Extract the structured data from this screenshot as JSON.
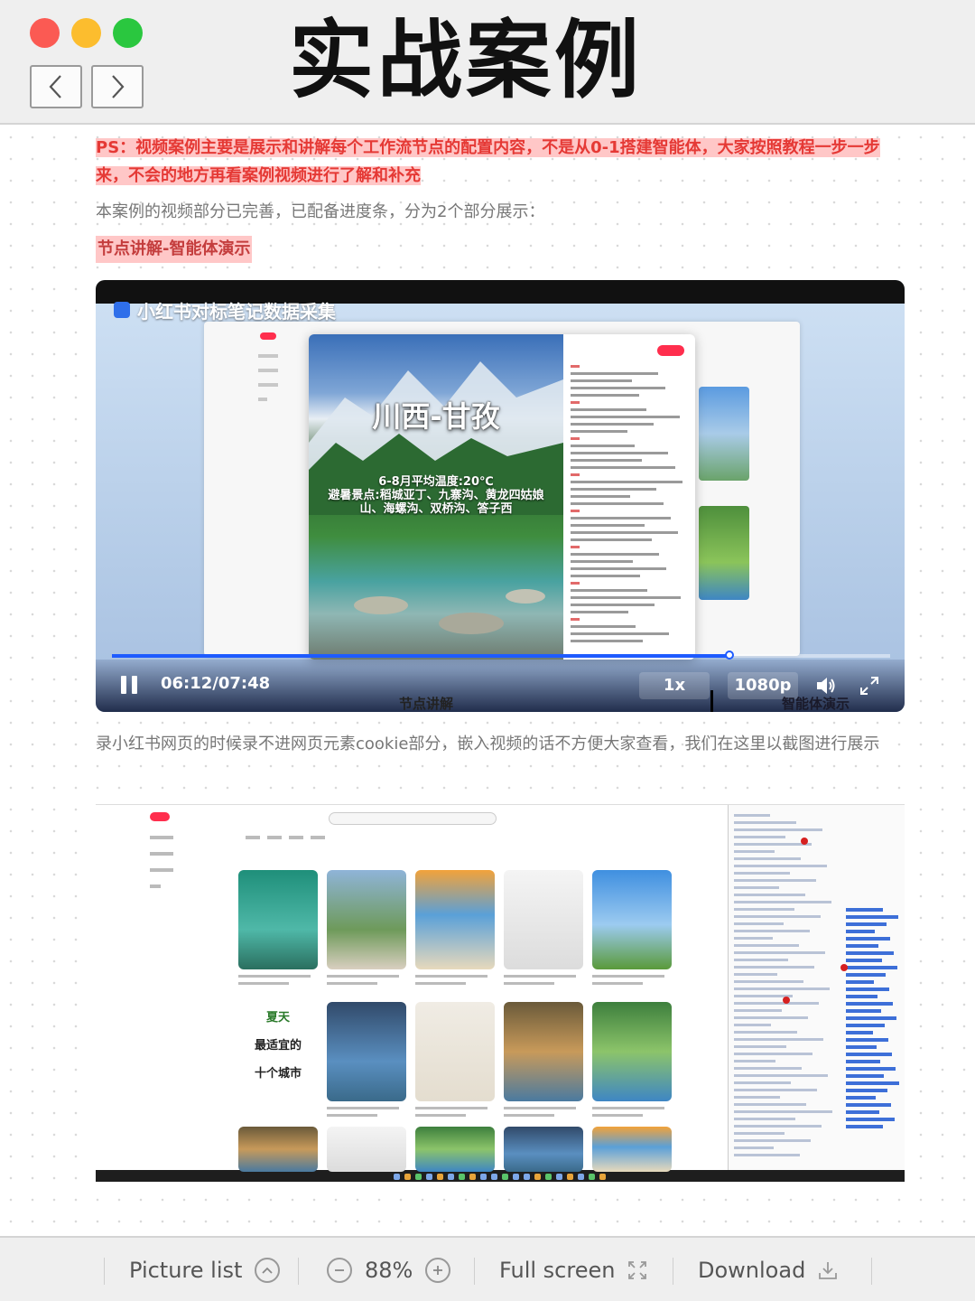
{
  "window": {
    "title": "实战案例",
    "controls": [
      "close",
      "minimize",
      "maximize"
    ],
    "nav": {
      "back_icon": "chevron-left-icon",
      "forward_icon": "chevron-right-icon"
    }
  },
  "article": {
    "ps_note": "PS：视频案例主要是展示和讲解每个工作流节点的配置内容，不是从0-1搭建智能体，大家按照教程一步一步来，不会的地方再看案例视频进行了解和补充",
    "intro": "本案例的视频部分已完善，已配备进度条，分为2个部分展示：",
    "section_heading": "节点讲解-智能体演示",
    "description": "录小红书网页的时候录不进网页元素cookie部分，嵌入视频的话不方便大家查看，我们在这里以截图进行展示"
  },
  "video": {
    "title": "小红书对标笔记数据采集",
    "post_title": "川西-甘孜",
    "post_caption": "6-8月平均温度:20℃\n避暑景点:稻城亚丁、九寨沟、黄龙四姑娘山、海螺沟、双桥沟、答子西",
    "current_time": "06:12",
    "duration": "07:48",
    "time_display": "06:12/07:48",
    "progress": 0.794,
    "speed": "1x",
    "quality": "1080p",
    "chapters": [
      "节点讲解",
      "智能体演示"
    ],
    "chapter_split": 0.76,
    "colors": {
      "progress": "#1e5bff"
    }
  },
  "screenshot": {
    "cards_text": [
      "夏天",
      "最适宜的",
      "十个城市"
    ]
  },
  "toolbar": {
    "picture_list": "Picture list",
    "zoom": "88%",
    "full_screen": "Full screen",
    "download": "Download"
  }
}
